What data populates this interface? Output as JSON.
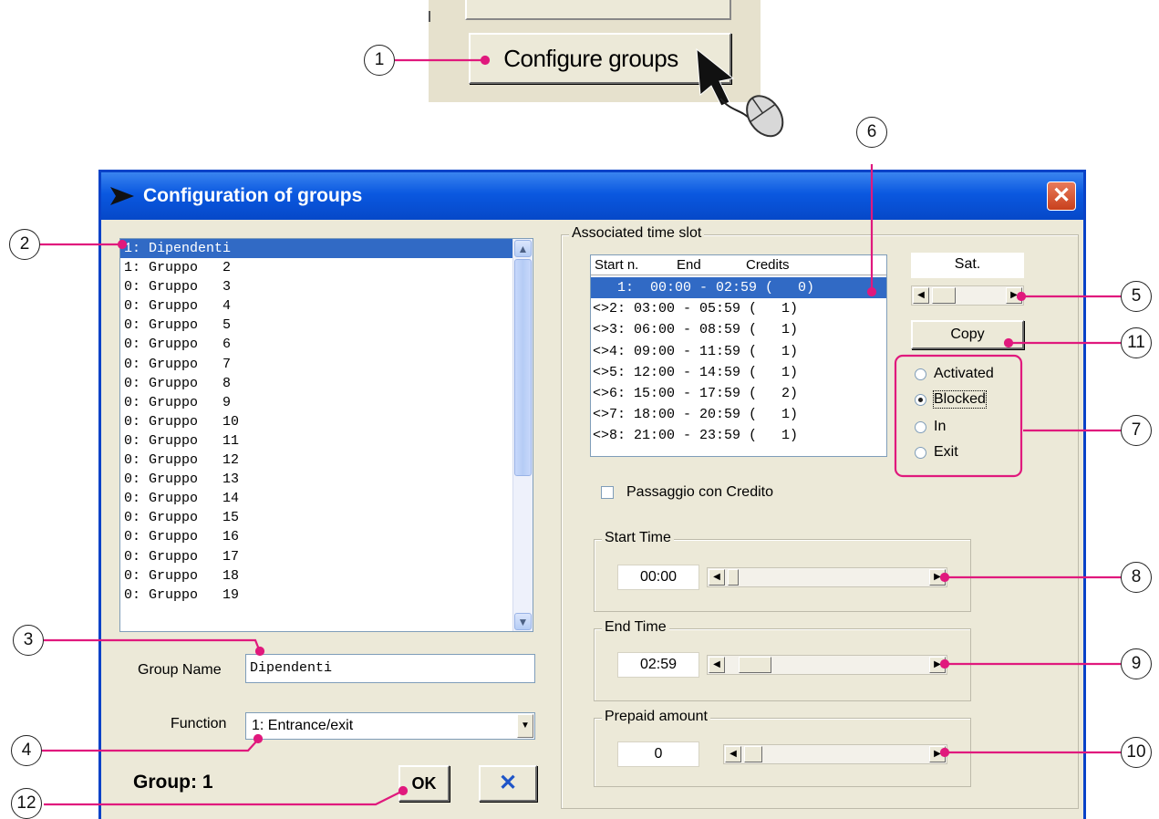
{
  "top": {
    "configure_button": "Configure groups"
  },
  "dialog": {
    "title": "Configuration of groups",
    "close": "✕"
  },
  "groups": [
    "1: Dipendenti",
    "1: Gruppo   2",
    "0: Gruppo   3",
    "0: Gruppo   4",
    "0: Gruppo   5",
    "0: Gruppo   6",
    "0: Gruppo   7",
    "0: Gruppo   8",
    "0: Gruppo   9",
    "0: Gruppo   10",
    "0: Gruppo   11",
    "0: Gruppo   12",
    "0: Gruppo   13",
    "0: Gruppo   14",
    "0: Gruppo   15",
    "0: Gruppo   16",
    "0: Gruppo   17",
    "0: Gruppo   18",
    "0: Gruppo   19"
  ],
  "group_name": {
    "label": "Group Name",
    "value": "Dipendenti"
  },
  "function": {
    "label": "Function",
    "value": "1: Entrance/exit"
  },
  "group_status": "Group: 1",
  "buttons": {
    "ok": "OK",
    "cancel": "✕",
    "copy": "Copy"
  },
  "time_slot": {
    "title": "Associated time slot",
    "headers": [
      "Start n.",
      "End",
      "Credits"
    ],
    "rows": [
      "   1:  00:00 - 02:59 (   0)",
      "<>2: 03:00 - 05:59 (   1)",
      "<>3: 06:00 - 08:59 (   1)",
      "<>4: 09:00 - 11:59 (   1)",
      "<>5: 12:00 - 14:59 (   1)",
      "<>6: 15:00 - 17:59 (   2)",
      "<>7: 18:00 - 20:59 (   1)",
      "<>8: 21:00 - 23:59 (   1)"
    ],
    "day": "Sat."
  },
  "radios": [
    "Activated",
    "Blocked",
    "In",
    "Exit"
  ],
  "radio_selected": "Blocked",
  "credit_checkbox": "Passaggio con Credito",
  "start_time": {
    "title": "Start Time",
    "value": "00:00"
  },
  "end_time": {
    "title": "End Time",
    "value": "02:59"
  },
  "prepaid": {
    "title": "Prepaid amount",
    "value": "0"
  },
  "callouts": [
    "1",
    "2",
    "3",
    "4",
    "5",
    "6",
    "7",
    "8",
    "9",
    "10",
    "11",
    "12"
  ]
}
